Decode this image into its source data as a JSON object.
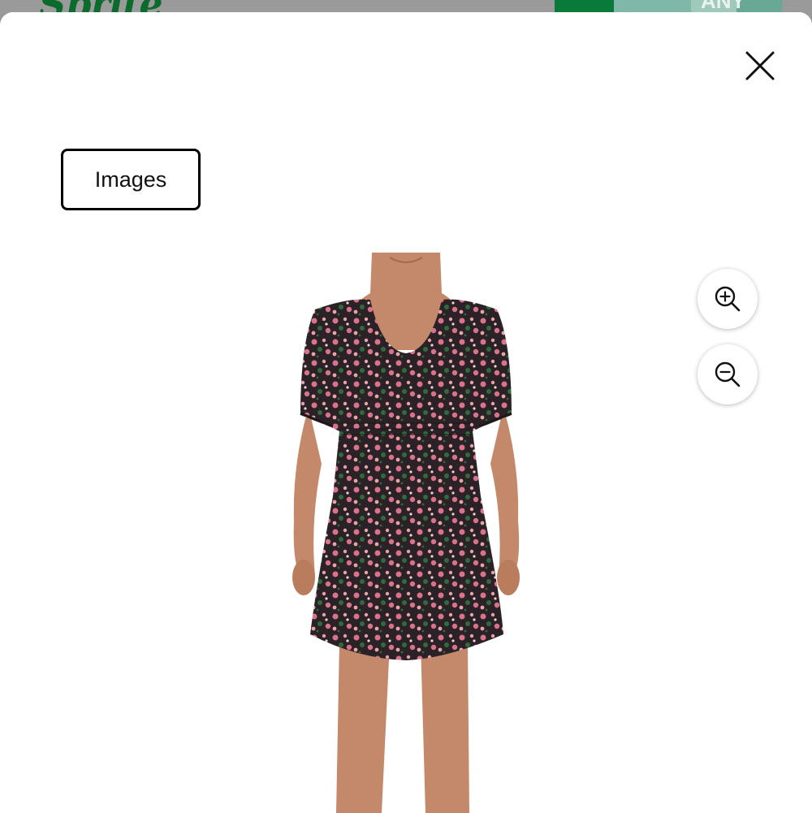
{
  "background": {
    "logo_text": "Sprite",
    "banner_text": "ANY"
  },
  "modal": {
    "close_icon": "close-icon",
    "tab_label": "Images",
    "product_image": {
      "dress_colors": [
        "#2a2226",
        "#d9728a",
        "#2f6b3c",
        "#e9a3a8"
      ],
      "skin_color": "#c4896a"
    },
    "zoom_in_icon": "zoom-in-icon",
    "zoom_out_icon": "zoom-out-icon"
  }
}
